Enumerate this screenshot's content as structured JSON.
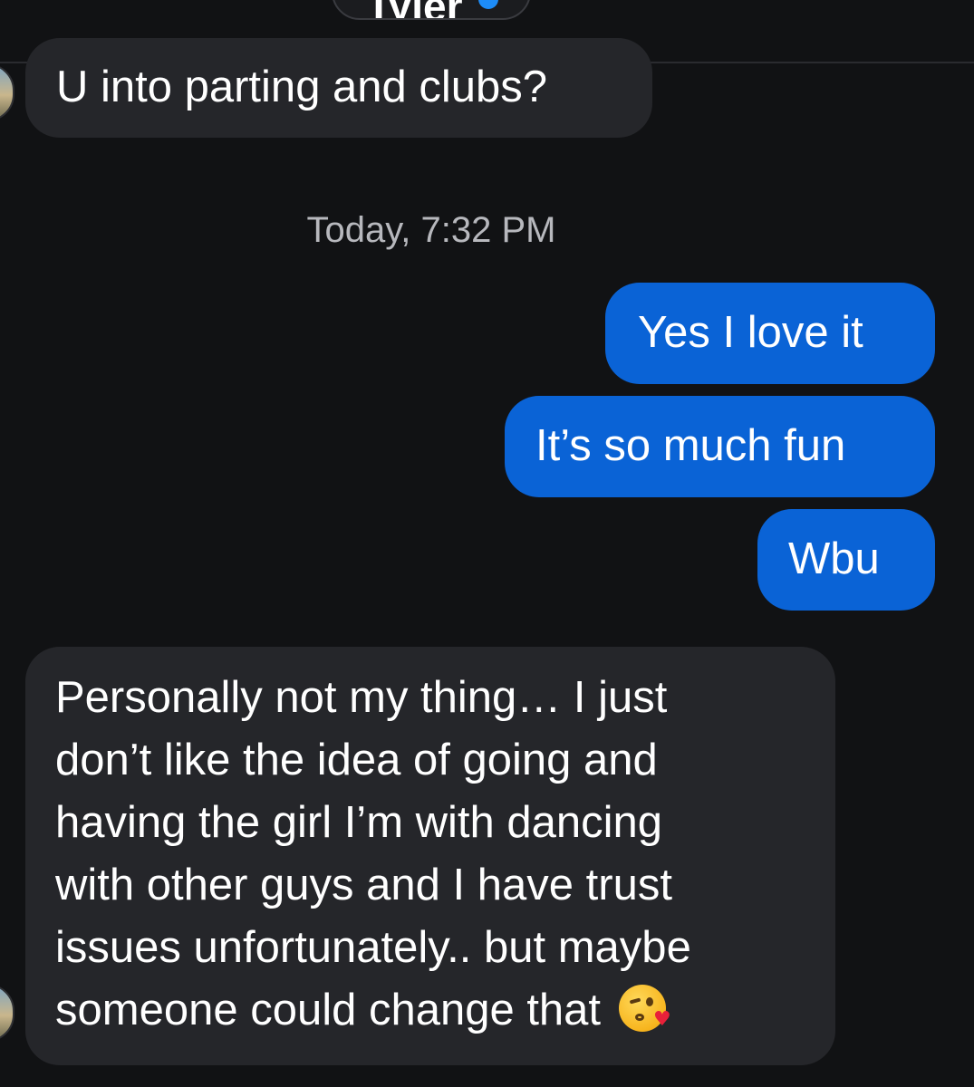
{
  "header": {
    "contact_name": "Tyler",
    "verified_icon": "verified-badge-icon"
  },
  "messages": [
    {
      "direction": "incoming",
      "text": "U into parting and clubs?"
    },
    {
      "direction": "outgoing",
      "text": "Yes I love it"
    },
    {
      "direction": "outgoing",
      "text": "It’s so much fun"
    },
    {
      "direction": "outgoing",
      "text": "Wbu"
    },
    {
      "direction": "incoming",
      "lines": [
        "Personally not my thing… I just",
        "don’t like the idea of going and",
        "having the girl I’m with dancing",
        "with other guys and I have trust",
        "issues unfortunately.. but maybe",
        "someone could change that"
      ],
      "emoji": "face-blowing-a-kiss-icon"
    }
  ],
  "timestamp": "Today, 7:32 PM",
  "colors": {
    "background": "#111214",
    "incoming_bubble": "#25262a",
    "outgoing_bubble": "#0a63d6",
    "timestamp_text": "#b7b8bd"
  }
}
